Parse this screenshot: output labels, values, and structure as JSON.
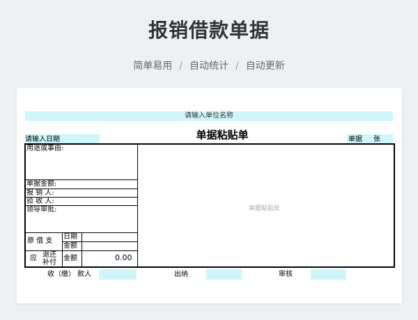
{
  "header": {
    "title": "报销借款单据",
    "subtitle_items": [
      "简单易用",
      "自动统计",
      "自动更新"
    ],
    "separator": "/"
  },
  "form": {
    "unit_placeholder": "请输入单位名称",
    "date_placeholder": "请输入日期",
    "doc_title": "单据粘贴单",
    "doc_count_label": "单据",
    "doc_count_unit": "张",
    "paste_hint": "单据粘贴处",
    "purpose_label": "用途或事由:",
    "amount_label": "单据金额:",
    "reimburser_label": "报  销  人:",
    "checker_label": "验  收  人:",
    "leader_label": "领导审批:",
    "borrow_label": "原 借 支",
    "date_label": "日期",
    "money_label": "金额",
    "settle_label": "应",
    "refund_label": "退还",
    "supplement_label": "补付",
    "settle_money_label": "金额",
    "settle_amount": "0.00"
  },
  "footer": {
    "payee_label": "收（缴） 款人",
    "cashier_label": "出纳",
    "reviewer_label": "审核"
  },
  "colors": {
    "accent_cyan": "#cff7fb",
    "background": "#eef1f4"
  }
}
